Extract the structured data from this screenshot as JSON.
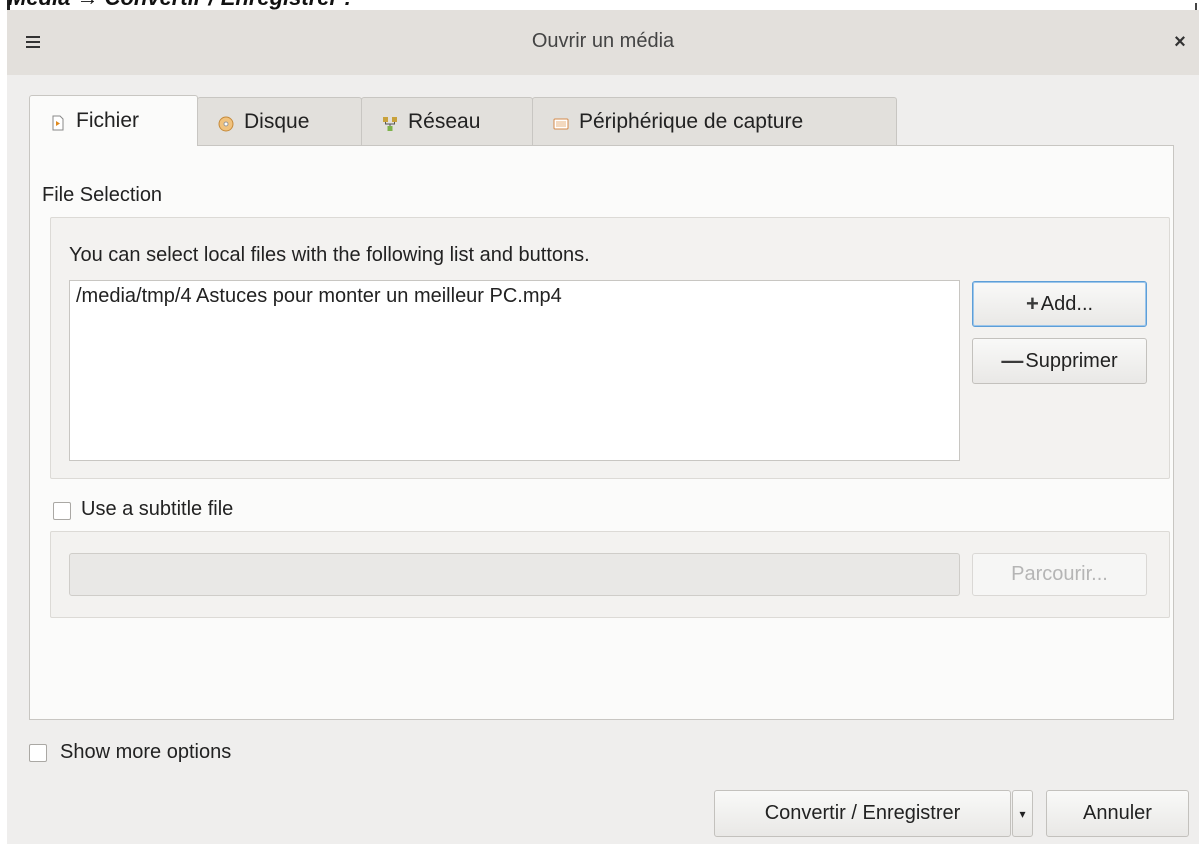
{
  "top_strip": {
    "text": "Media → Convertir / Enregistrer :"
  },
  "dialog": {
    "title": "Ouvrir un média",
    "tabs": [
      {
        "label": "Fichier",
        "mnemonic": "F",
        "icon": "file-icon",
        "active": true
      },
      {
        "label": "Disque",
        "mnemonic": "D",
        "icon": "disc-icon",
        "active": false
      },
      {
        "label": "Réseau",
        "mnemonic": "R",
        "icon": "network-icon",
        "active": false
      },
      {
        "label": "Périphérique de capture",
        "mnemonic": "t",
        "icon": "capture-device-icon",
        "active": false
      }
    ],
    "file_section": {
      "title": "File Selection",
      "hint": "You can select local files with the following list and buttons.",
      "files": [
        "/media/tmp/4 Astuces pour monter un meilleur PC.mp4"
      ],
      "add_label": "Add...",
      "remove_label": "Supprimer"
    },
    "subtitle": {
      "checkbox_label": "Use a subtitle file",
      "checked": false,
      "path_value": "",
      "browse_label": "Parcourir..."
    },
    "show_more": {
      "label": "Show more options",
      "checked": false
    },
    "footer": {
      "primary_label": "Convertir / Enregistrer",
      "cancel_label": "Annuler"
    }
  },
  "colors": {
    "window_bg": "#efeeed",
    "titlebar_bg": "#e3e0dc",
    "focus_ring": "#5d9ed8"
  }
}
